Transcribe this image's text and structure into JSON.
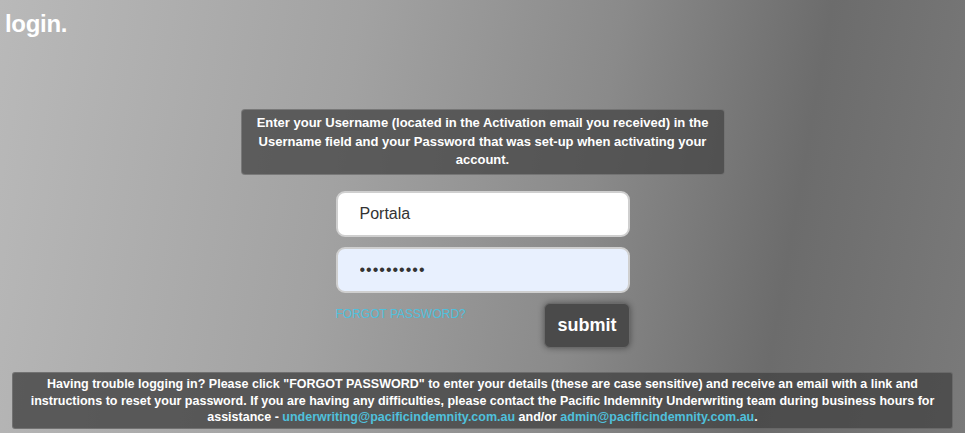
{
  "page": {
    "title": "login."
  },
  "instructions": "Enter your Username (located in the Activation email you received) in the Username field and your Password that was set-up when activating your account.",
  "form": {
    "username": {
      "value": "Portala"
    },
    "password": {
      "value": "••••••••••"
    },
    "forgot_link": "FORGOT PASSWORD?",
    "submit": "submit"
  },
  "help": {
    "segments": [
      {
        "kind": "text",
        "text": "Having trouble logging in? Please click \"FORGOT PASSWORD\" to enter your details (these are case sensitive) and receive an email with a link and instructions to reset your password. If you are having any difficulties, please contact the Pacific Indemnity Underwriting team during business hours for assistance - "
      },
      {
        "kind": "link",
        "text": "underwriting@pacificindemnity.com.au"
      },
      {
        "kind": "text",
        "text": " and/or "
      },
      {
        "kind": "link",
        "text": "admin@pacificindemnity.com.au"
      },
      {
        "kind": "text",
        "text": "."
      }
    ]
  }
}
